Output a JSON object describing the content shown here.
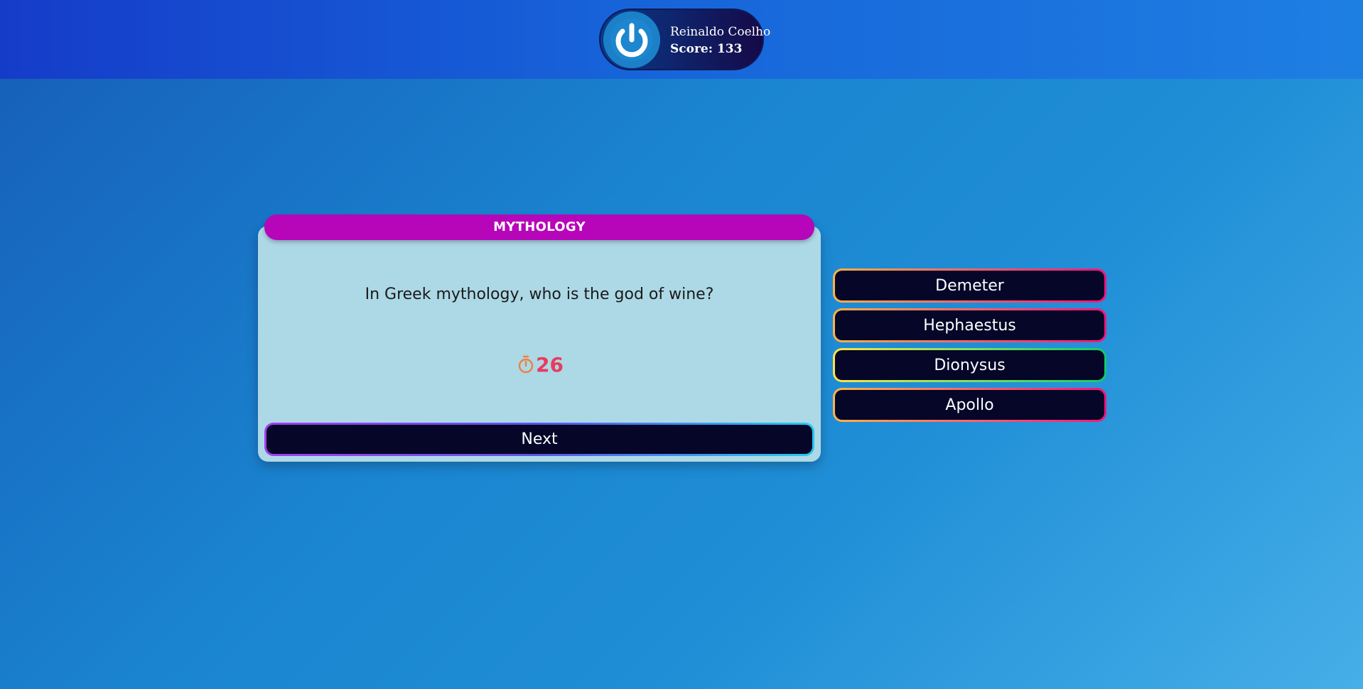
{
  "player": {
    "name": "Reinaldo Coelho",
    "score_text": "Score: 133",
    "power_icon": "power-icon"
  },
  "question": {
    "category": "MYTHOLOGY",
    "text": "In Greek mythology, who is the god of wine?",
    "timer_icon": "stopwatch-icon",
    "timer_value": "26",
    "next_label": "Next"
  },
  "answers": [
    {
      "label": "Demeter",
      "state": "wrong"
    },
    {
      "label": "Hephaestus",
      "state": "wrong"
    },
    {
      "label": "Dionysus",
      "state": "correct"
    },
    {
      "label": "Apollo",
      "state": "wrong"
    }
  ],
  "colors": {
    "category_bg": "#b705b9",
    "card_bg": "#add8e6",
    "button_bg": "#050628",
    "timer": "#e83b5c",
    "correct_border": "#12c96a",
    "wrong_border": "#f5157f"
  }
}
